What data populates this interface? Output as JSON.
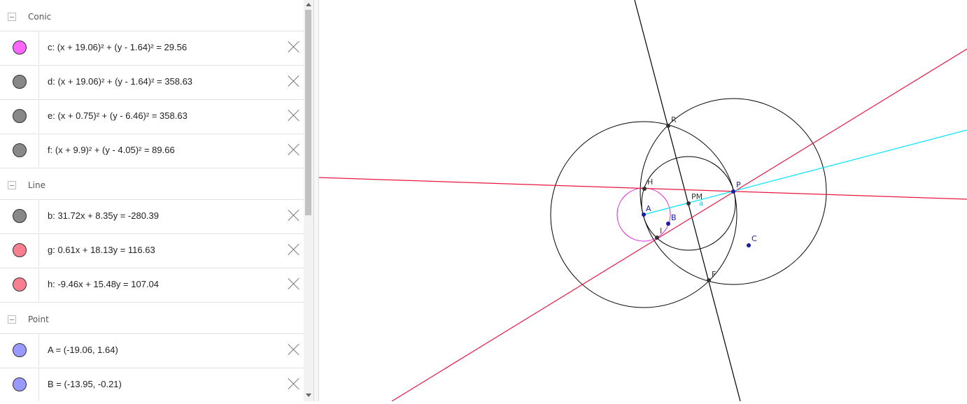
{
  "algebra": {
    "groups": {
      "conic": "Conic",
      "line": "Line",
      "point": "Point"
    },
    "rows": [
      {
        "expr": "c: (x + 19.06)² + (y - 1.64)² = 29.56",
        "color": "#ff66ff"
      },
      {
        "expr": "d: (x + 19.06)² + (y - 1.64)² = 358.63",
        "color": "#888888"
      },
      {
        "expr": "e: (x + 0.75)² + (y - 6.46)² = 358.63",
        "color": "#888888"
      },
      {
        "expr": "f: (x + 9.9)² + (y - 4.05)² = 89.66",
        "color": "#888888"
      },
      {
        "expr": "b: 31.72x + 8.35y = -280.39",
        "color": "#888888"
      },
      {
        "expr": "g: 0.61x + 18.13y = 116.63",
        "color": "#f77f8f"
      },
      {
        "expr": "h: -9.46x + 15.48y = 107.04",
        "color": "#f77f8f"
      },
      {
        "expr": "A = (-19.06, 1.64)",
        "color": "#9999ff"
      },
      {
        "expr": "B = (-13.95, -0.21)",
        "color": "#9999ff"
      }
    ]
  },
  "graphics": {
    "labels": {
      "R": "R",
      "H": "H",
      "A": "A",
      "B": "B",
      "I": "I",
      "PM": "PM",
      "a": "a",
      "P": "P",
      "C": "C",
      "F": "F"
    },
    "colors": {
      "black_line": "#000000",
      "red_line": "#e8173f",
      "cyan_segment": "#00e5ff",
      "magenta_circle": "#e020d0",
      "blue_point": "#1a1aa6",
      "dark_point": "#333333"
    }
  }
}
